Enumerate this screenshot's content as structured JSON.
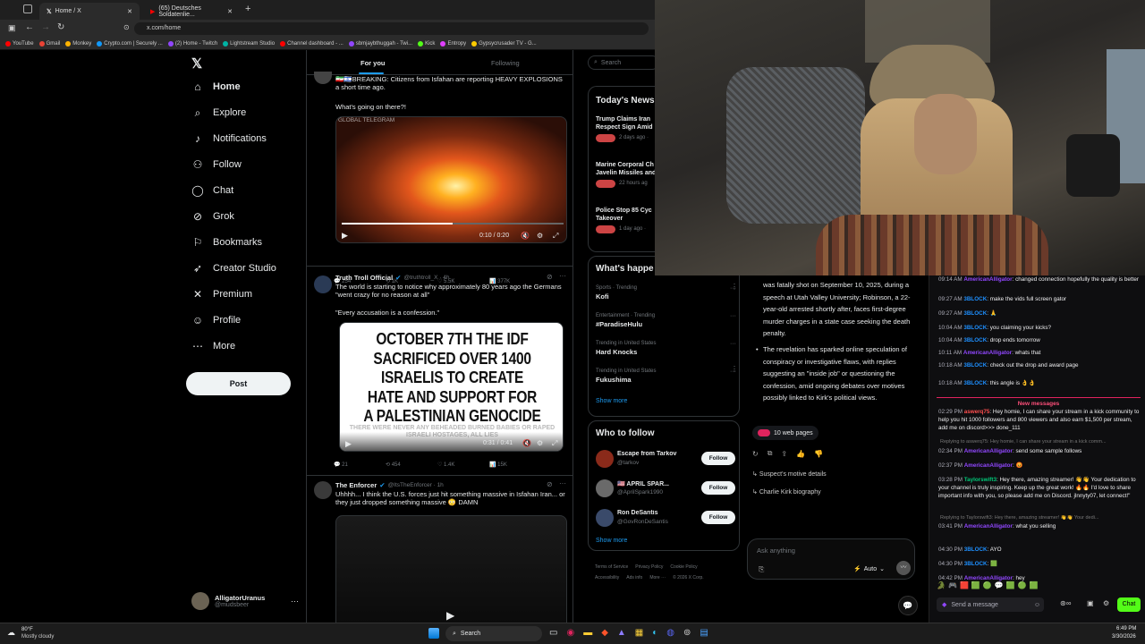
{
  "browser": {
    "tabs": [
      {
        "label": "Home / X",
        "active": true
      },
      {
        "label": "(65) Deutsches Soldatenlie...",
        "active": false
      }
    ],
    "url": "x.com/home",
    "bookmarks": [
      {
        "label": "YouTube",
        "color": "#ff0000"
      },
      {
        "label": "Gmail",
        "color": "#ea4335"
      },
      {
        "label": "Monkey",
        "color": "#ffb300"
      },
      {
        "label": "Crypto.com | Securely ...",
        "color": "#1199fa"
      },
      {
        "label": "(2) Home - Twitch",
        "color": "#9146ff"
      },
      {
        "label": "Lightstream Studio",
        "color": "#00b3a4"
      },
      {
        "label": "Channel dashboard - ...",
        "color": "#ff0000"
      },
      {
        "label": "sbmjaybthuggah - Twi...",
        "color": "#9146ff"
      },
      {
        "label": "Kick",
        "color": "#53fc18"
      },
      {
        "label": "Entropy",
        "color": "#e040fb"
      },
      {
        "label": "Gypsycrusader TV - G...",
        "color": "#ffcc00"
      }
    ]
  },
  "nav": {
    "items": [
      {
        "label": "Home",
        "icon": "home-icon",
        "glyph": "⌂"
      },
      {
        "label": "Explore",
        "icon": "search-icon",
        "glyph": "⌕"
      },
      {
        "label": "Notifications",
        "icon": "bell-icon",
        "glyph": "♪"
      },
      {
        "label": "Follow",
        "icon": "person-add-icon",
        "glyph": "⚇"
      },
      {
        "label": "Chat",
        "icon": "chat-icon",
        "glyph": "◯"
      },
      {
        "label": "Grok",
        "icon": "grok-icon",
        "glyph": "⊘"
      },
      {
        "label": "Bookmarks",
        "icon": "bookmark-icon",
        "glyph": "⚐"
      },
      {
        "label": "Creator Studio",
        "icon": "rocket-icon",
        "glyph": "➶"
      },
      {
        "label": "Premium",
        "icon": "x-logo-icon",
        "glyph": "✕"
      },
      {
        "label": "Profile",
        "icon": "profile-icon",
        "glyph": "☺"
      },
      {
        "label": "More",
        "icon": "more-circle-icon",
        "glyph": "⋯"
      }
    ],
    "post_label": "Post",
    "account_name": "AlligatorUranus",
    "account_handle": "@mudsbeer"
  },
  "feed": {
    "tab_foryou": "For you",
    "tab_following": "Following",
    "tweets": [
      {
        "text": "🇮🇷🇮🇱BREAKING: Citizens from Isfahan are reporting HEAVY EXPLOSIONS a short time ago.",
        "text2": "What's going on there?!",
        "media_label": "GLOBAL TELEGRAM",
        "video_time": "0:10 / 0:20",
        "replies": "254",
        "reposts": "1K",
        "likes": "5.5K",
        "views": "377K"
      },
      {
        "author": "Truth Troll Official",
        "handle": "@truthtroll_X · 4h",
        "text": "The world is starting to notice why approximately 80 years ago the Germans \"went crazy for no reason at all\"",
        "text2": "\"Every accusation is a confession.\"",
        "image_text": "OCTOBER 7TH THE IDF SACRIFICED OVER 1400 ISRAELIS TO CREATE HATE AND SUPPORT FOR A PALESTINIAN GENOCIDE",
        "image_subtext": "THERE WERE NEVER ANY BEHEADED BURNED BABIES OR RAPED ISRAELI HOSTAGES, ALL LIES",
        "video_time": "0:31 / 0:41",
        "replies": "21",
        "reposts": "454",
        "likes": "1.4K",
        "views": "15K"
      },
      {
        "author": "The Enforcer",
        "handle": "@ItsTheEnforcer · 1h",
        "text": "Uhhhh... I think the U.S. forces just hit something massive in Isfahan Iran... or they just dropped something massive 😳 DAMN"
      }
    ]
  },
  "right": {
    "search_placeholder": "Search",
    "news_title": "Today's News",
    "news": [
      {
        "title": "Trump Claims Iran Respect Sign Amid",
        "meta": "2 days ago ·"
      },
      {
        "title": "Marine Corporal Ch Javelin Missiles and",
        "meta": "22 hours ag"
      },
      {
        "title": "Police Stop 85 Cyc Takeover",
        "meta": "1 day ago ·"
      }
    ],
    "happening_title": "What's happe",
    "trends": [
      {
        "context": "Sports · Trending",
        "name": "Kofi"
      },
      {
        "context": "Entertainment · Trending",
        "name": "#ParadiseHulu"
      },
      {
        "context": "Trending in United States",
        "name": "Hard Knocks"
      },
      {
        "context": "Trending in United States",
        "name": "Fukushima"
      }
    ],
    "show_more": "Show more",
    "who_title": "Who to follow",
    "who": [
      {
        "name": "Escape from Tarkov",
        "handle": "@tarkov",
        "color": "#8a2a1a"
      },
      {
        "name": "🇺🇸 APRIL SPAR...",
        "handle": "@AprilSpark1990",
        "color": "#6a6a6a"
      },
      {
        "name": "Ron DeSantis",
        "handle": "@GovRonDeSantis",
        "color": "#3a4a6a"
      }
    ],
    "follow_label": "Follow",
    "footer": [
      "Terms of Service",
      "Privacy Policy",
      "Cookie Policy",
      "Accessibility",
      "Ads info",
      "More ···",
      "© 2026 X Corp."
    ]
  },
  "grok": {
    "para1": "was fatally shot on September 10, 2025, during a speech at Utah Valley University; Robinson, a 22-year-old arrested shortly after, faces first-degree murder charges in a state case seeking the death penalty.",
    "bullet": "The revelation has sparked online speculation of conspiracy or investigative flaws, with replies suggesting an \"inside job\" or questioning the confession, amid ongoing debates over motives possibly linked to Kirk's political views.",
    "sources": "10 web pages",
    "suggestions": [
      "Suspect's motive details",
      "Charlie Kirk biography"
    ],
    "input_placeholder": "Ask anything",
    "mode": "Auto"
  },
  "chat": {
    "messages": [
      {
        "time": "09:14 AM",
        "user": "AmericanAlligator",
        "cls": "u1",
        "text": ": changed connection hopefully the quality is better"
      },
      {
        "time": "09:27 AM",
        "user": "3BLOCK",
        "cls": "u3",
        "text": ": make the vids full screen gator"
      },
      {
        "time": "09:27 AM",
        "user": "3BLOCK",
        "cls": "u3",
        "text": ": 🙏"
      },
      {
        "time": "10:04 AM",
        "user": "3BLOCK",
        "cls": "u3",
        "text": ": you claiming your kicks?"
      },
      {
        "time": "10:04 AM",
        "user": "3BLOCK",
        "cls": "u3",
        "text": ": drop ends tomorrow"
      },
      {
        "time": "10:11 AM",
        "user": "AmericanAlligator",
        "cls": "u1",
        "text": ": whats that"
      },
      {
        "time": "10:18 AM",
        "user": "3BLOCK",
        "cls": "u3",
        "text": ": check out the drop and award page"
      },
      {
        "time": "10:18 AM",
        "user": "3BLOCK",
        "cls": "u3",
        "text": ": this angle is 👌👌"
      },
      {
        "time": "02:29 PM",
        "user": "aswerq75",
        "cls": "u2",
        "text": ": Hey homie, I can share your stream in a kick community to help you hit 1000 followers and 800 viewers and also earn $1,500 per stream, add me on discord>>> done_111"
      },
      {
        "time": "02:34 PM",
        "user": "AmericanAlligator",
        "cls": "u1",
        "text": ": send some sample follows"
      },
      {
        "time": "02:37 PM",
        "user": "AmericanAlligator",
        "cls": "u1",
        "text": ": 😡"
      },
      {
        "time": "03:28 PM",
        "user": "Taylorswift3",
        "cls": "u4",
        "text": ": Hey there, amazing streamer! 👋👋 Your dedication to your channel is truly inspiring. Keep up the great work! 🔥🔥 I'd love to share important info with you, so please add me on Discord. jlnnyty07, let connect!\""
      },
      {
        "time": "03:41 PM",
        "user": "AmericanAlligator",
        "cls": "u1",
        "text": ": what you selling"
      },
      {
        "time": "04:30 PM",
        "user": "3BLOCK",
        "cls": "u3",
        "text": ": AYO"
      },
      {
        "time": "04:30 PM",
        "user": "3BLOCK",
        "cls": "u3",
        "text": ": 🟩"
      },
      {
        "time": "04:42 PM",
        "user": "AmericanAlligator",
        "cls": "u1",
        "text": ": hey"
      }
    ],
    "new_messages": "New messages",
    "reply1": "Replying to aswerq75: Hey homie, I can share your stream in a kick comm...",
    "reply2": "Replying to Taylorswift3: Hey there, amazing streamer! 👋👋 Your dedi...",
    "input_placeholder": "Send a message",
    "chat_button": "Chat"
  },
  "taskbar": {
    "temp": "80°F",
    "weather": "Mostly cloudy",
    "search": "Search",
    "time": "6:49 PM",
    "date": "3/30/2026"
  }
}
